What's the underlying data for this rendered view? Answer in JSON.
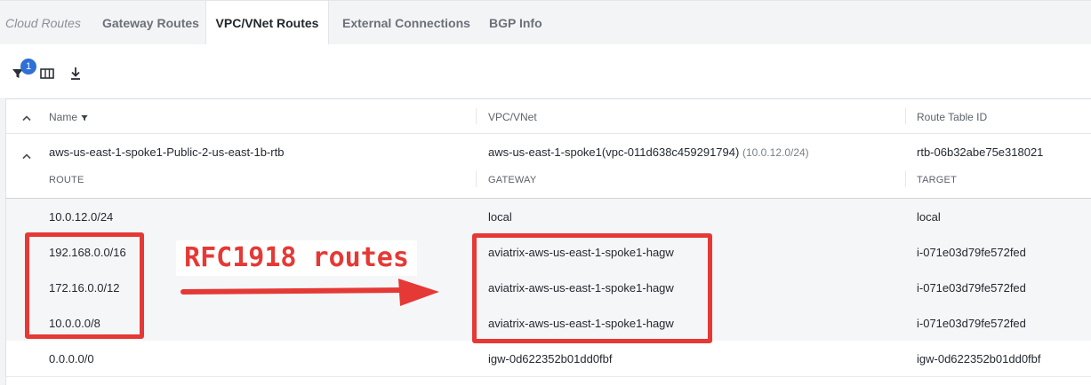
{
  "tabs": [
    {
      "label": "Cloud Routes"
    },
    {
      "label": "Gateway Routes"
    },
    {
      "label": "VPC/VNet Routes"
    },
    {
      "label": "External Connections"
    },
    {
      "label": "BGP Info"
    }
  ],
  "active_tab": "VPC/VNet Routes",
  "toolbar": {
    "filter_count": "1",
    "icons": [
      "filter-icon",
      "columns-icon",
      "download-icon"
    ]
  },
  "table": {
    "headers": {
      "name": "Name",
      "vpc": "VPC/VNet",
      "route_table": "Route Table ID"
    },
    "group": {
      "name": "aws-us-east-1-spoke1-Public-2-us-east-1b-rtb",
      "vpc": "aws-us-east-1-spoke1(vpc-011d638c459291794)",
      "vpc_cidr": "(10.0.12.0/24)",
      "route_table_id": "rtb-06b32abe75e318021"
    },
    "subheaders": {
      "route": "ROUTE",
      "gateway": "GATEWAY",
      "target": "TARGET"
    },
    "rows": [
      {
        "route": "10.0.12.0/24",
        "gateway": "local",
        "target": "local"
      },
      {
        "route": "192.168.0.0/16",
        "gateway": "aviatrix-aws-us-east-1-spoke1-hagw",
        "target": "i-071e03d79fe572fed"
      },
      {
        "route": "172.16.0.0/12",
        "gateway": "aviatrix-aws-us-east-1-spoke1-hagw",
        "target": "i-071e03d79fe572fed"
      },
      {
        "route": "10.0.0.0/8",
        "gateway": "aviatrix-aws-us-east-1-spoke1-hagw",
        "target": "i-071e03d79fe572fed"
      },
      {
        "route": "0.0.0.0/0",
        "gateway": "igw-0d622352b01dd0fbf",
        "target": "igw-0d622352b01dd0fbf"
      }
    ]
  },
  "annotation": {
    "label": "RFC1918 routes",
    "color": "#e53935"
  },
  "colors": {
    "accent": "#2f6fd6",
    "annotation": "#e53935"
  }
}
